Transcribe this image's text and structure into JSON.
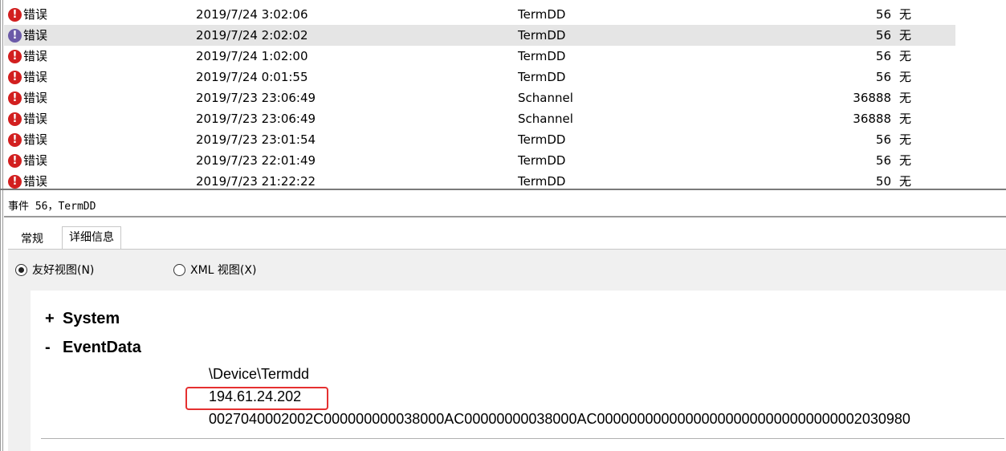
{
  "events": [
    {
      "level": "错误",
      "date": "2019/7/24 3:02:06",
      "source": "TermDD",
      "id": "56",
      "task": "无",
      "selected": false
    },
    {
      "level": "错误",
      "date": "2019/7/24 2:02:02",
      "source": "TermDD",
      "id": "56",
      "task": "无",
      "selected": true
    },
    {
      "level": "错误",
      "date": "2019/7/24 1:02:00",
      "source": "TermDD",
      "id": "56",
      "task": "无",
      "selected": false
    },
    {
      "level": "错误",
      "date": "2019/7/24 0:01:55",
      "source": "TermDD",
      "id": "56",
      "task": "无",
      "selected": false
    },
    {
      "level": "错误",
      "date": "2019/7/23 23:06:49",
      "source": "Schannel",
      "id": "36888",
      "task": "无",
      "selected": false
    },
    {
      "level": "错误",
      "date": "2019/7/23 23:06:49",
      "source": "Schannel",
      "id": "36888",
      "task": "无",
      "selected": false
    },
    {
      "level": "错误",
      "date": "2019/7/23 23:01:54",
      "source": "TermDD",
      "id": "56",
      "task": "无",
      "selected": false
    },
    {
      "level": "错误",
      "date": "2019/7/23 22:01:49",
      "source": "TermDD",
      "id": "56",
      "task": "无",
      "selected": false
    },
    {
      "level": "错误",
      "date": "2019/7/23 21:22:22",
      "source": "TermDD",
      "id": "50",
      "task": "无",
      "selected": false
    }
  ],
  "detail": {
    "title": "事件 56，TermDD",
    "tabs": [
      "常规",
      "详细信息"
    ],
    "view_friendly": "友好视图(N)",
    "view_xml": "XML 视图(X)",
    "system_toggle": "+",
    "system_label": "System",
    "eventdata_toggle": "-",
    "eventdata_label": "EventData",
    "device": "\\Device\\Termdd",
    "ip": "194.61.24.202",
    "binary": "0027040002002C000000000038000AC00000000038000AC000000000000000000000000000000002030980"
  },
  "colors": {
    "error_icon": "#d21f1f",
    "highlight": "#e53030",
    "selection": "#e5e5e5"
  },
  "icons": {
    "error": "error-icon"
  }
}
